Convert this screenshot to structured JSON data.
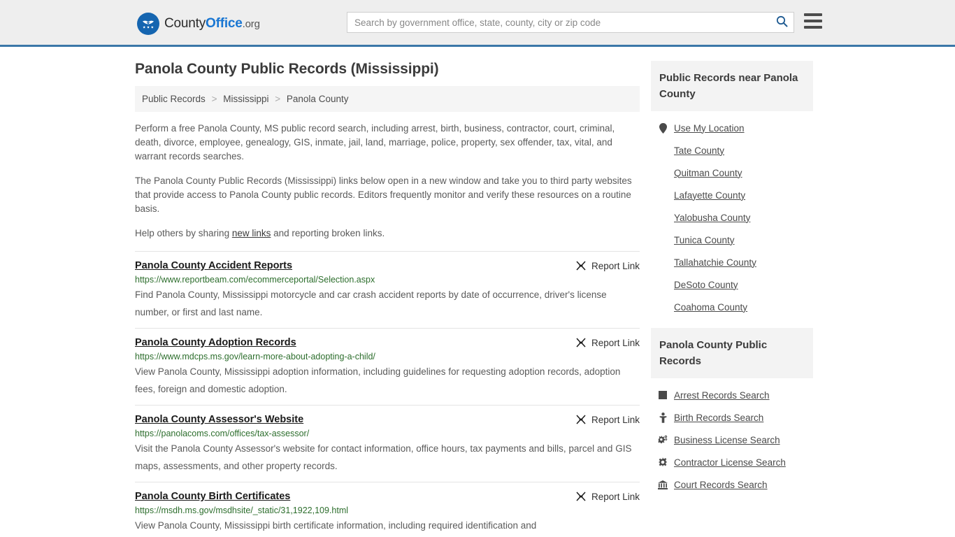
{
  "header": {
    "logo_name": "County",
    "logo_name_bold": "Office",
    "logo_tld": ".org",
    "search_placeholder": "Search by government office, state, county, city or zip code",
    "search_value": "",
    "search_icon": "search-icon",
    "menu_icon": "hamburger-menu-icon",
    "accent_color": "#3b77a8"
  },
  "main": {
    "page_title": "Panola County Public Records (Mississippi)",
    "breadcrumb": [
      {
        "label": "Public Records"
      },
      {
        "label": "Mississippi"
      },
      {
        "label": "Panola County"
      }
    ],
    "breadcrumb_separator": ">",
    "intro_paragraph_1": "Perform a free Panola County, MS public record search, including arrest, birth, business, contractor, court, criminal, death, divorce, employee, genealogy, GIS, inmate, jail, land, marriage, police, property, sex offender, tax, vital, and warrant records searches.",
    "intro_paragraph_2": "The Panola County Public Records (Mississippi) links below open in a new window and take you to third party websites that provide access to Panola County public records. Editors frequently monitor and verify these resources on a routine basis.",
    "help_prefix": "Help others by sharing ",
    "help_link": "new links",
    "help_suffix": " and reporting broken links.",
    "report_link_label": "Report Link",
    "report_link_icon": "broken-link-icon",
    "records": [
      {
        "title": "Panola County Accident Reports",
        "url": "https://www.reportbeam.com/ecommerceportal/Selection.aspx",
        "description": "Find Panola County, Mississippi motorcycle and car crash accident reports by date of occurrence, driver's license number, or first and last name."
      },
      {
        "title": "Panola County Adoption Records",
        "url": "https://www.mdcps.ms.gov/learn-more-about-adopting-a-child/",
        "description": "View Panola County, Mississippi adoption information, including guidelines for requesting adoption records, adoption fees, foreign and domestic adoption."
      },
      {
        "title": "Panola County Assessor's Website",
        "url": "https://panolacoms.com/offices/tax-assessor/",
        "description": "Visit the Panola County Assessor's website for contact information, office hours, tax payments and bills, parcel and GIS maps, assessments, and other property records."
      },
      {
        "title": "Panola County Birth Certificates",
        "url": "https://msdh.ms.gov/msdhsite/_static/31,1922,109.html",
        "description": "View Panola County, Mississippi birth certificate information, including required identification and"
      }
    ]
  },
  "sidebar": {
    "nearby_panel": {
      "title": "Public Records near Panola County",
      "items": [
        {
          "label": "Use My Location",
          "icon": "map-pin-icon"
        },
        {
          "label": "Tate County",
          "icon": ""
        },
        {
          "label": "Quitman County",
          "icon": ""
        },
        {
          "label": "Lafayette County",
          "icon": ""
        },
        {
          "label": "Yalobusha County",
          "icon": ""
        },
        {
          "label": "Tunica County",
          "icon": ""
        },
        {
          "label": "Tallahatchie County",
          "icon": ""
        },
        {
          "label": "DeSoto County",
          "icon": ""
        },
        {
          "label": "Coahoma County",
          "icon": ""
        }
      ]
    },
    "records_panel": {
      "title": "Panola County Public Records",
      "items": [
        {
          "label": "Arrest Records Search",
          "icon": "jail-block-icon"
        },
        {
          "label": "Birth Records Search",
          "icon": "baby-icon"
        },
        {
          "label": "Business License Search",
          "icon": "gears-icon"
        },
        {
          "label": "Contractor License Search",
          "icon": "gear-icon"
        },
        {
          "label": "Court Records Search",
          "icon": "courthouse-icon"
        }
      ]
    }
  }
}
